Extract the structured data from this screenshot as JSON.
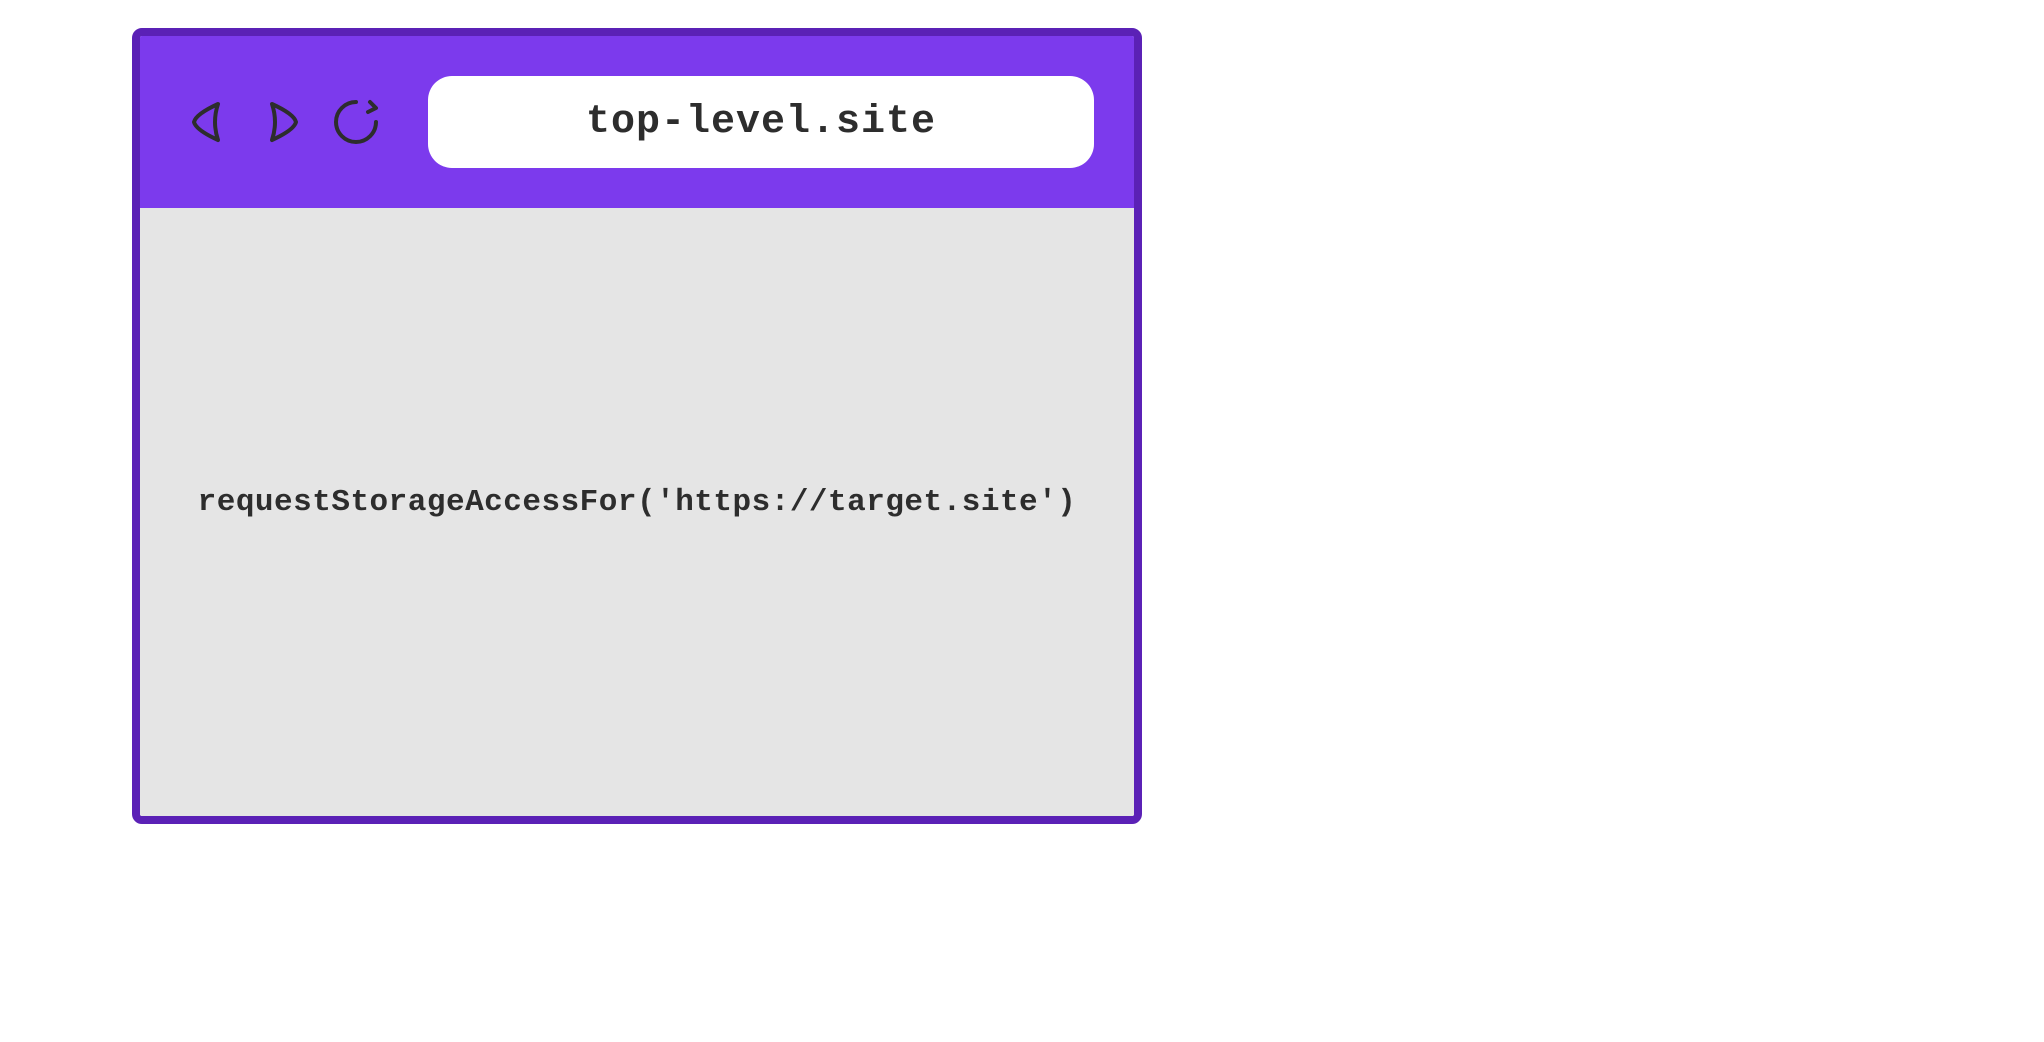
{
  "browser": {
    "url": "top-level.site",
    "content": "requestStorageAccessFor('https://target.site')"
  },
  "colors": {
    "toolbar": "#7c3aed",
    "border": "#5b21b6",
    "content_bg": "#e5e5e5",
    "text": "#2d2d2d",
    "icon_stroke": "#2d2d2d"
  }
}
